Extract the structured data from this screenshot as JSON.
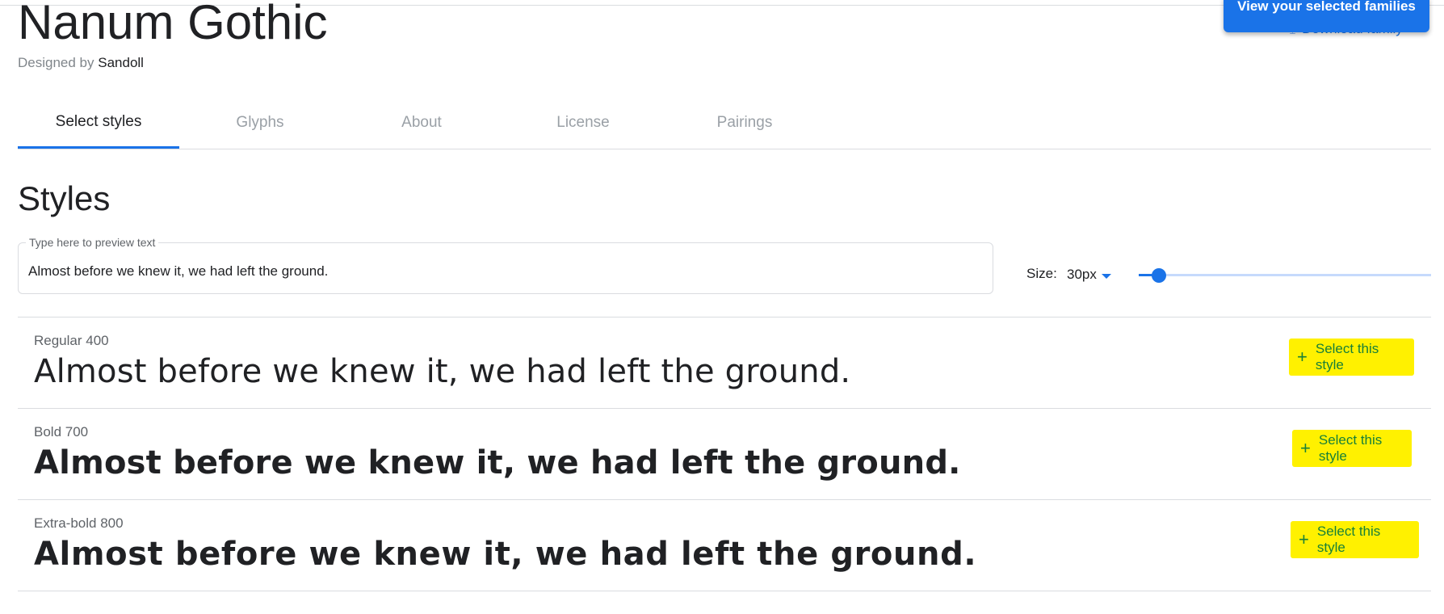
{
  "header": {
    "family_name": "Nanum Gothic",
    "designed_by_label": "Designed by",
    "designer": "Sandoll",
    "view_selected_label": "View your selected families",
    "download_label": "Download family",
    "download_icon": "download-icon"
  },
  "tabs": [
    {
      "label": "Select styles",
      "active": true
    },
    {
      "label": "Glyphs",
      "active": false
    },
    {
      "label": "About",
      "active": false
    },
    {
      "label": "License",
      "active": false
    },
    {
      "label": "Pairings",
      "active": false
    }
  ],
  "styles_section": {
    "heading": "Styles",
    "preview": {
      "label": "Type here to preview text",
      "value": "Almost before we knew it, we had left the ground."
    },
    "size": {
      "label": "Size:",
      "value": "30px",
      "slider_fraction": 0.07
    },
    "rows": [
      {
        "name": "Regular 400",
        "sample": "Almost before we knew it, we had left the ground.",
        "button": "Select this style",
        "icon": "plus-icon"
      },
      {
        "name": "Bold 700",
        "sample": "Almost before we knew it, we had left the ground.",
        "button": "Select this style",
        "icon": "plus-icon"
      },
      {
        "name": "Extra-bold 800",
        "sample": "Almost before we knew it, we had left the ground.",
        "button": "Select this style",
        "icon": "plus-icon"
      }
    ]
  },
  "colors": {
    "accent": "#1a73e8",
    "highlight": "#fff100",
    "select_text": "#188038"
  }
}
